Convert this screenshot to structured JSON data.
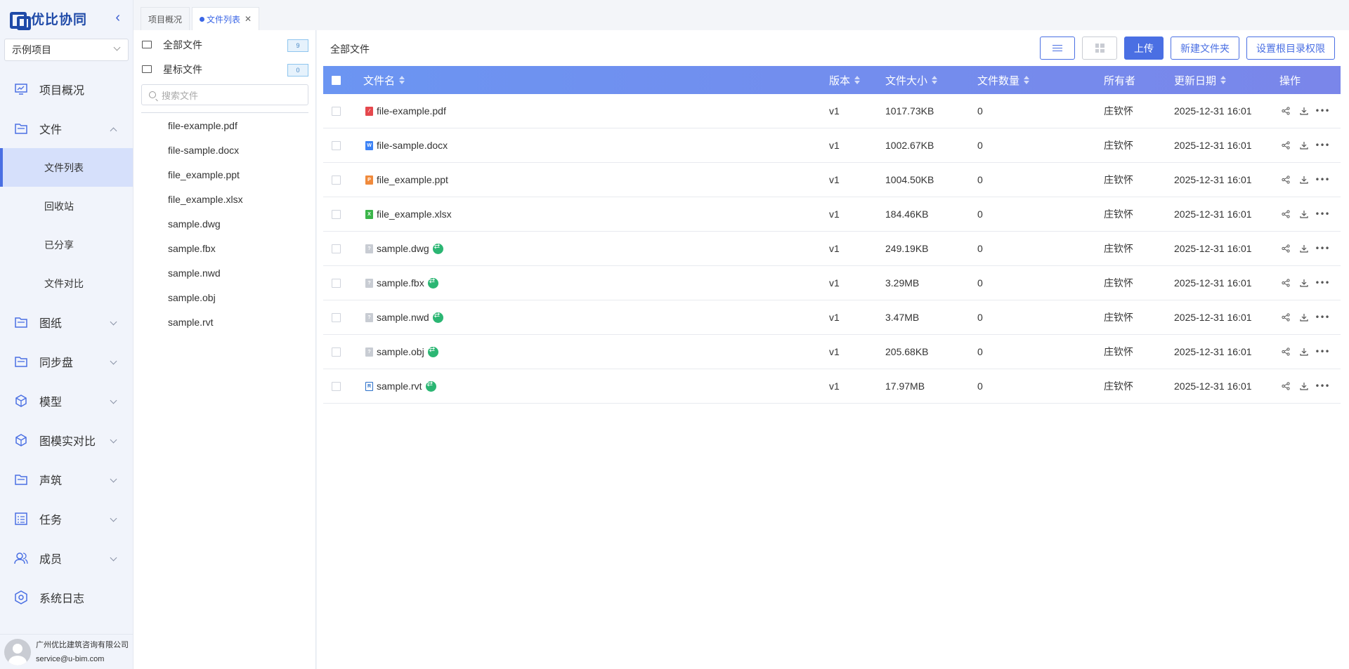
{
  "app": {
    "logo_text": "优比协同"
  },
  "sidebar": {
    "project": "示例项目",
    "items": [
      {
        "label": "项目概况"
      },
      {
        "label": "文件"
      },
      {
        "label": "图纸"
      },
      {
        "label": "同步盘"
      },
      {
        "label": "模型"
      },
      {
        "label": "图模实对比"
      },
      {
        "label": "声筑"
      },
      {
        "label": "任务"
      },
      {
        "label": "成员"
      },
      {
        "label": "系统日志"
      }
    ],
    "sub_items": [
      {
        "label": "文件列表"
      },
      {
        "label": "回收站"
      },
      {
        "label": "已分享"
      },
      {
        "label": "文件对比"
      }
    ],
    "user": {
      "company": "广州优比建筑咨询有限公司",
      "email": "service@u-bim.com"
    }
  },
  "tabs": [
    {
      "label": "项目概况"
    },
    {
      "label": "文件列表"
    }
  ],
  "tree": {
    "all_files": "全部文件",
    "all_count": "9",
    "starred": "星标文件",
    "starred_count": "0",
    "search_placeholder": "搜索文件",
    "files": [
      "file-example.pdf",
      "file-sample.docx",
      "file_example.ppt",
      "file_example.xlsx",
      "sample.dwg",
      "sample.fbx",
      "sample.nwd",
      "sample.obj",
      "sample.rvt"
    ]
  },
  "main": {
    "title": "全部文件",
    "toolbar": {
      "upload": "上传",
      "new_folder": "新建文件夹",
      "root_perm": "设置根目录权限"
    },
    "columns": {
      "name": "文件名",
      "version": "版本",
      "size": "文件大小",
      "count": "文件数量",
      "owner": "所有者",
      "date": "更新日期",
      "ops": "操作"
    },
    "rows": [
      {
        "name": "file-example.pdf",
        "type": "pdf",
        "version": "v1",
        "size": "1017.73KB",
        "count": "0",
        "owner": "庄钦怀",
        "date": "2025-12-31 16:01",
        "sync": false
      },
      {
        "name": "file-sample.docx",
        "type": "docx",
        "version": "v1",
        "size": "1002.67KB",
        "count": "0",
        "owner": "庄钦怀",
        "date": "2025-12-31 16:01",
        "sync": false
      },
      {
        "name": "file_example.ppt",
        "type": "ppt",
        "version": "v1",
        "size": "1004.50KB",
        "count": "0",
        "owner": "庄钦怀",
        "date": "2025-12-31 16:01",
        "sync": false
      },
      {
        "name": "file_example.xlsx",
        "type": "xlsx",
        "version": "v1",
        "size": "184.46KB",
        "count": "0",
        "owner": "庄钦怀",
        "date": "2025-12-31 16:01",
        "sync": false
      },
      {
        "name": "sample.dwg",
        "type": "unknown",
        "version": "v1",
        "size": "249.19KB",
        "count": "0",
        "owner": "庄钦怀",
        "date": "2025-12-31 16:01",
        "sync": true
      },
      {
        "name": "sample.fbx",
        "type": "unknown",
        "version": "v1",
        "size": "3.29MB",
        "count": "0",
        "owner": "庄钦怀",
        "date": "2025-12-31 16:01",
        "sync": true
      },
      {
        "name": "sample.nwd",
        "type": "unknown",
        "version": "v1",
        "size": "3.47MB",
        "count": "0",
        "owner": "庄钦怀",
        "date": "2025-12-31 16:01",
        "sync": true
      },
      {
        "name": "sample.obj",
        "type": "unknown",
        "version": "v1",
        "size": "205.68KB",
        "count": "0",
        "owner": "庄钦怀",
        "date": "2025-12-31 16:01",
        "sync": true
      },
      {
        "name": "sample.rvt",
        "type": "rvt",
        "version": "v1",
        "size": "17.97MB",
        "count": "0",
        "owner": "庄钦怀",
        "date": "2025-12-31 16:01",
        "sync": true
      }
    ]
  },
  "colors": {
    "accent": "#4a6fe3",
    "pdf": "#e5484d",
    "docx": "#3b82f6",
    "ppt": "#f08a3c",
    "xlsx": "#3bb54a",
    "unknown": "#c8ccd3",
    "rvt": "#2a6fc9",
    "sync": "#2bb673"
  }
}
